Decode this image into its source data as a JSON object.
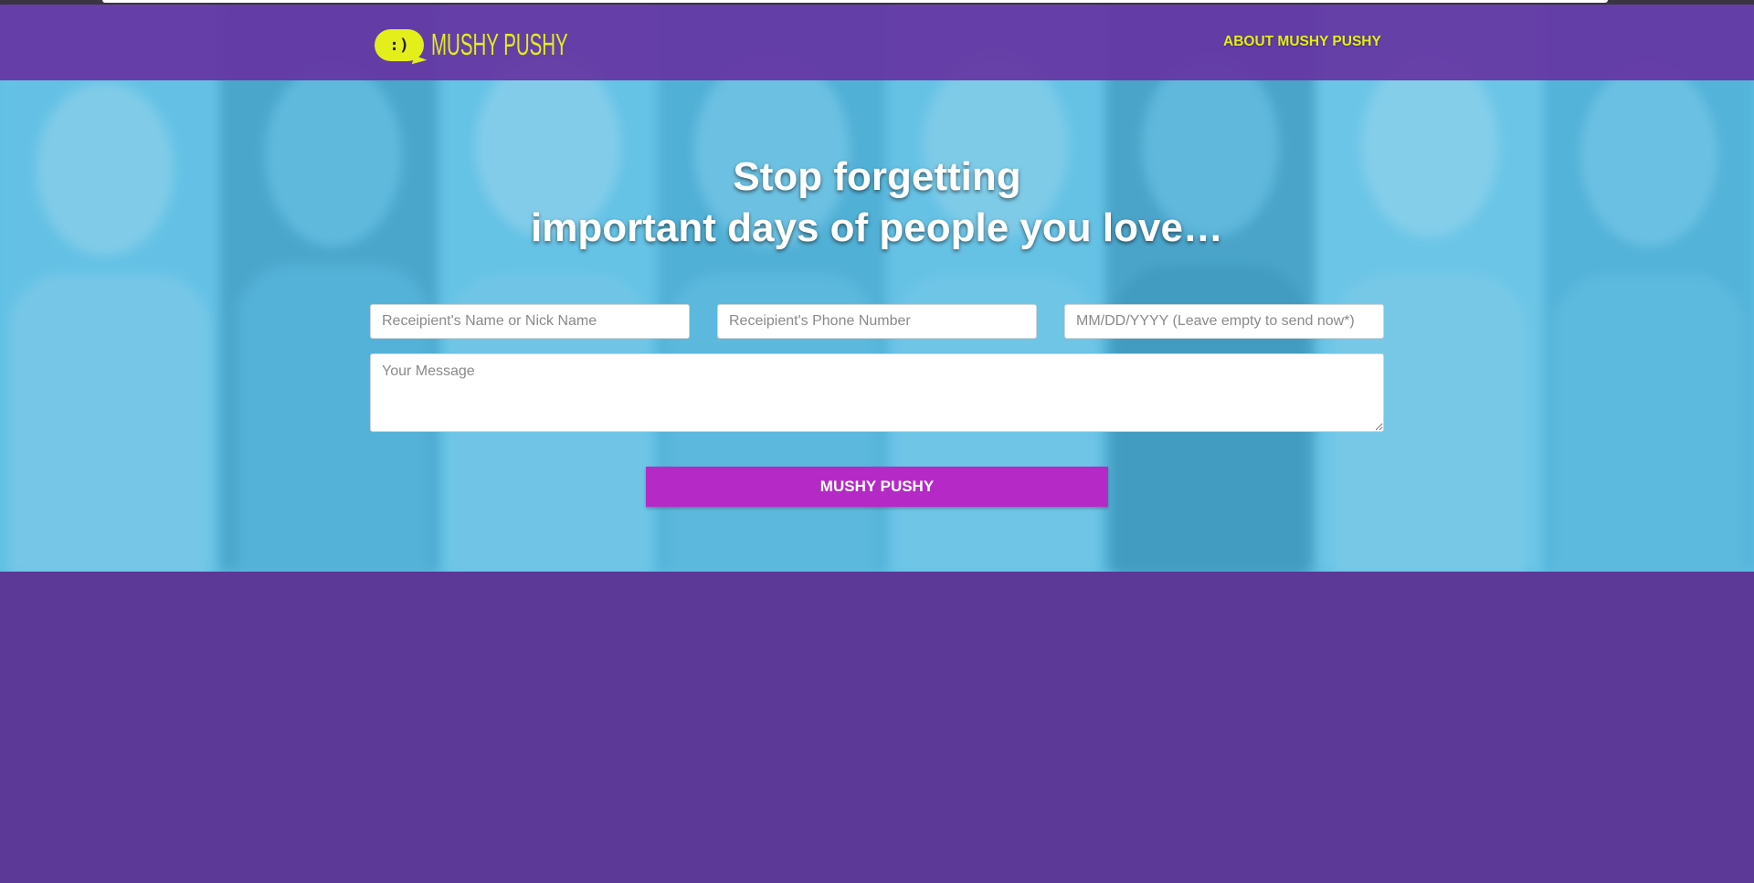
{
  "header": {
    "logo_face": ":)",
    "logo_text": "MUSHY PUSHY",
    "nav_about": "ABOUT MUSHY PUSHY"
  },
  "hero": {
    "headline_line1": "Stop forgetting",
    "headline_line2": "important days of people you love…"
  },
  "form": {
    "name_placeholder": "Receipient's Name or Nick Name",
    "phone_placeholder": "Receipient's Phone Number",
    "date_placeholder": "MM/DD/YYYY (Leave empty to send now*)",
    "message_placeholder": "Your Message",
    "submit_label": "MUSHY PUSHY"
  },
  "colors": {
    "header_bg": "#6534a2",
    "brand_yellow": "#e3ee1a",
    "hero_blue": "#5dc1e5",
    "button_magenta": "#b52ac6",
    "lower_purple": "#5c3897"
  }
}
